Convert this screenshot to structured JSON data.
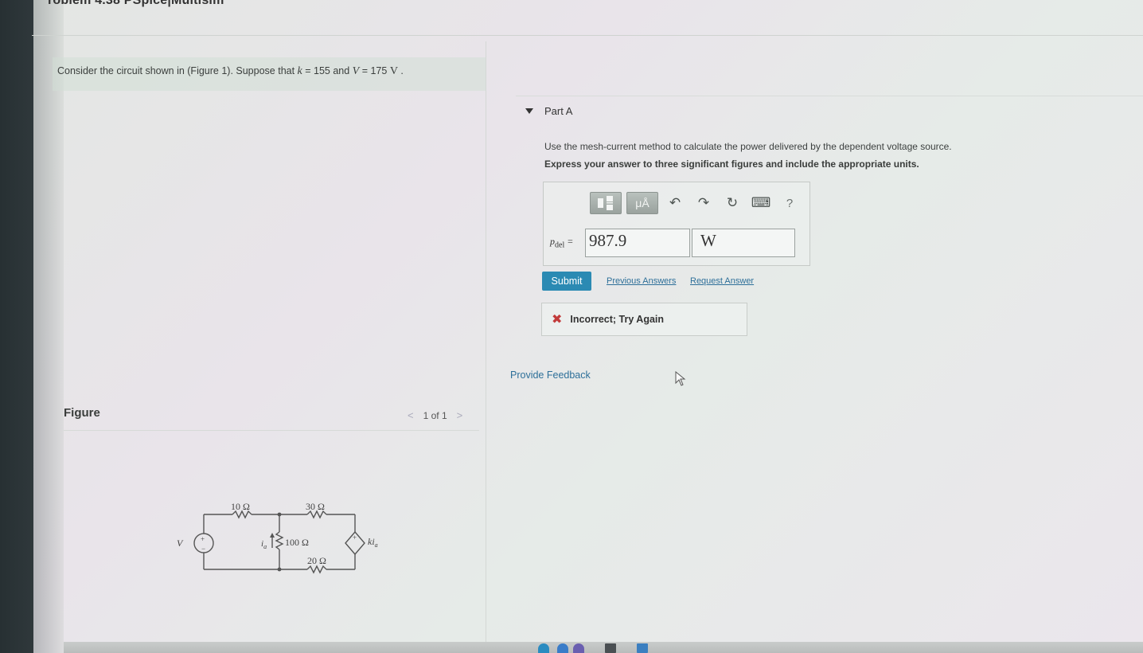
{
  "page": {
    "title": "roblem 4.38 PSpice|Multisim"
  },
  "problem": {
    "text_before": "Consider the circuit shown in (Figure 1). Suppose that ",
    "k_symbol": "k",
    "eq1": " = 155 and ",
    "v_symbol": "V",
    "eq2": " = 175 ",
    "v_unit": "V",
    "end": " ."
  },
  "figure": {
    "label": "Figure",
    "nav_prev": "<",
    "pager": "1 of 1",
    "nav_next": ">",
    "circuit": {
      "r1": "10 Ω",
      "r2": "30 Ω",
      "r3": "100 Ω",
      "r4": "20 Ω",
      "source": "V",
      "current": "i",
      "current_sub": "a",
      "dep_source": "ki",
      "dep_sub": "a",
      "plus": "+",
      "minus": "−"
    }
  },
  "part": {
    "label": "Part A",
    "instruction": "Use the mesh-current method to calculate the power delivered by the dependent voltage source.",
    "express": "Express your answer to three significant figures and include the appropriate units."
  },
  "toolbar": {
    "template_icon": "fraction-template-icon",
    "units_label": "μÅ",
    "undo": "↶",
    "redo": "↷",
    "reset": "↻",
    "keyboard": "⌨",
    "help": "?"
  },
  "answer": {
    "var": "p",
    "var_sub": "del",
    "equals": " = ",
    "value": "987.9",
    "unit": "W"
  },
  "actions": {
    "submit": "Submit",
    "previous_answers": "Previous Answers",
    "request_answer": "Request Answer"
  },
  "feedback": {
    "icon": "✖",
    "message": "Incorrect; Try Again"
  },
  "provide_feedback": "Provide Feedback"
}
